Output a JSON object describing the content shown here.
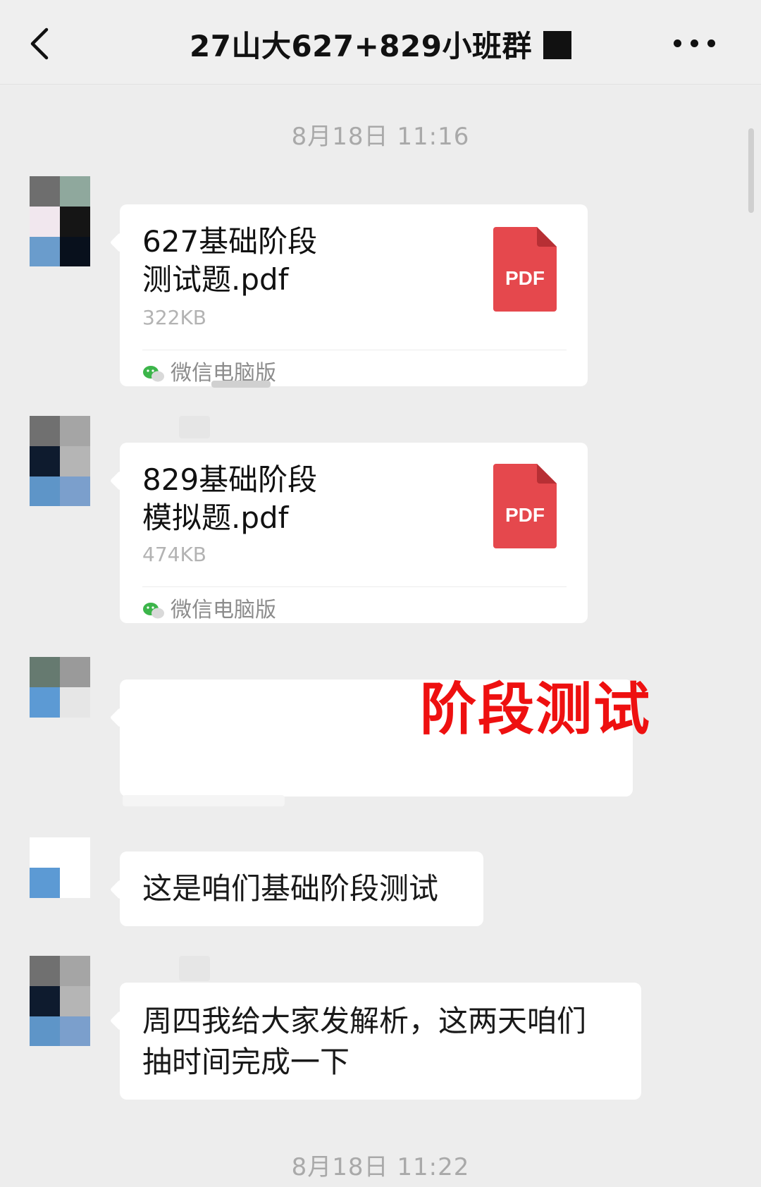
{
  "header": {
    "title": "27山大627+829小班群",
    "back_icon": "chevron-left-icon",
    "more_icon": "more-dots-icon"
  },
  "timestamps": [
    "8月18日 11:16",
    "8月18日 11:22"
  ],
  "files": [
    {
      "name_line1": "627基础阶段",
      "name_line2": "测试题.pdf",
      "size": "322KB",
      "icon_label": "PDF",
      "source": "微信电脑版"
    },
    {
      "name_line1": "829基础阶段",
      "name_line2": "模拟题.pdf",
      "size": "474KB",
      "icon_label": "PDF",
      "source": "微信电脑版"
    }
  ],
  "messages": {
    "m1": "这是咱们基础阶段测试",
    "m2_line1": "周四我给大家发解析，这两天咱们",
    "m2_line2": "抽时间完成一下"
  },
  "overlay_stamp": "阶段测试",
  "colors": {
    "pdf_red": "#e5484d",
    "stamp_red": "#ee1010",
    "wechat_green": "#3cb54a"
  }
}
